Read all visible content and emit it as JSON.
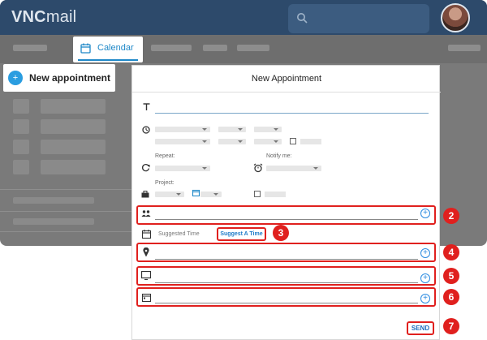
{
  "app": {
    "logo_bold": "VNC",
    "logo_rest": "mail"
  },
  "nav": {
    "active_tab_label": "Calendar"
  },
  "sidebar": {
    "new_appointment_label": "New appointment",
    "new_appointment_icon": "+"
  },
  "dialog": {
    "title": "New Appointment",
    "repeat_label": "Repeat:",
    "notify_label": "Notify me:",
    "project_label": "Project:",
    "suggested_time_label": "Suggested Time",
    "suggest_button_label": "Suggest A Time",
    "send_button_label": "SEND",
    "add_icon": "+"
  },
  "callouts": [
    "2",
    "3",
    "4",
    "5",
    "6",
    "7"
  ],
  "colors": {
    "accent": "#1e88c8",
    "highlight": "#e0201e",
    "topbar": "#2d4a6b"
  }
}
